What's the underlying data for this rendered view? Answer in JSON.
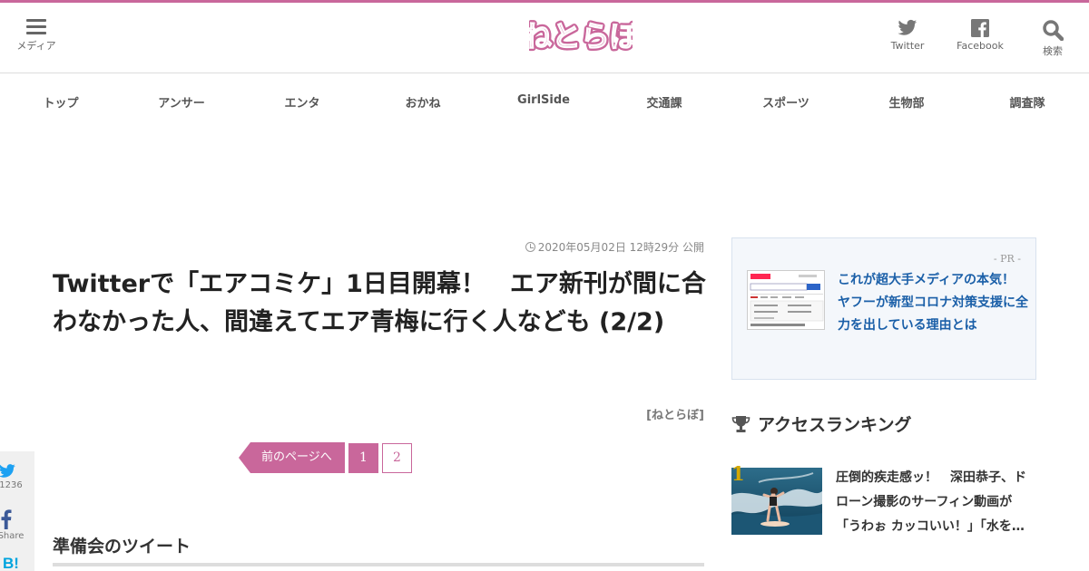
{
  "header": {
    "menu_label": "メディア",
    "logo_text": "ねとらぼ",
    "twitter_label": "Twitter",
    "facebook_label": "Facebook",
    "search_label": "検索"
  },
  "nav": {
    "items": [
      "トップ",
      "アンサー",
      "エンタ",
      "おかね",
      "GirlSide",
      "交通課",
      "スポーツ",
      "生物部",
      "調査隊"
    ]
  },
  "article": {
    "date": "2020年05月02日 12時29分 公開",
    "title": "Twitterで「エアコミケ」1日目開幕！　エア新刊が間に合わなかった人、間違えてエア青梅に行く人なども (2/2)",
    "byline": "[ねとらぼ]",
    "section_heading": "準備会のツイート"
  },
  "pager": {
    "prev_label": "前のページへ",
    "pages": [
      "1",
      "2"
    ],
    "current": "1"
  },
  "share": {
    "twitter_count": "1236",
    "facebook_label": "Share",
    "hatena_label": "B!"
  },
  "pr": {
    "label": "- PR -",
    "text": "これが超大手メディアの本気！　ヤフーが新型コロナ対策支援に全力を出している理由とは"
  },
  "ranking": {
    "heading": "アクセスランキング",
    "items": [
      {
        "rank": "1",
        "title": "圧倒的疾走感ッ！　深田恭子、ドローン撮影のサーフィン動画が「うわぉ カッコいい！」「水を…"
      }
    ]
  },
  "colors": {
    "brand": "#c9679b",
    "link": "#1a5fa8",
    "rank_gold": "#d4a800"
  }
}
